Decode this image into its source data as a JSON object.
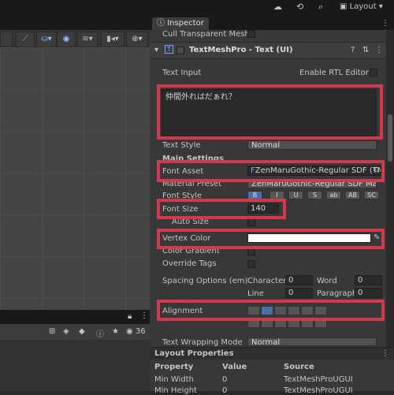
{
  "toolbar": {
    "cloud_icon": "cloud-icon",
    "history_icon": "history-icon",
    "search_icon": "search-icon",
    "layout_label": "Layout"
  },
  "scene": {
    "tools": [
      "▲▼",
      "◉",
      "≡",
      "▮▯",
      "⊕"
    ]
  },
  "bottom_panel": {
    "count_label": "36"
  },
  "inspector": {
    "tab_label": "Inspector",
    "cull_label": "Cull Transparent Mesh",
    "component_title": "TextMeshPro - Text (UI)",
    "text_input_label": "Text Input",
    "rtl_label": "Enable RTL Editor",
    "text_value": "仲間外れはだぁれ？",
    "text_style_label": "Text Style",
    "text_style_value": "Normal",
    "main_settings_label": "Main Settings",
    "font_asset_label": "Font Asset",
    "font_asset_value": "ZenMaruGothic-Regular SDF (TM",
    "material_preset_label": "Material Preset",
    "material_preset_value": "ZenMaruGothic-Regular SDF Material",
    "font_style_label": "Font Style",
    "font_style_buttons": [
      "B",
      "I",
      "U",
      "S",
      "ab",
      "AB",
      "SC"
    ],
    "font_size_label": "Font Size",
    "font_size_value": "140",
    "auto_size_label": "Auto Size",
    "vertex_color_label": "Vertex Color",
    "vertex_color_value": "#ffffff",
    "color_gradient_label": "Color Gradient",
    "override_tags_label": "Override Tags",
    "spacing_label": "Spacing Options (em)",
    "character_label": "Character",
    "character_value": "0",
    "word_label": "Word",
    "word_value": "0",
    "line_label": "Line",
    "line_value": "0",
    "paragraph_label": "Paragraph",
    "paragraph_value": "0",
    "alignment_label": "Alignment",
    "wrapping_label": "Text Wrapping Mode",
    "wrapping_value": "Normal"
  },
  "layout_properties": {
    "header": "Layout Properties",
    "col_property": "Property",
    "col_value": "Value",
    "col_source": "Source",
    "rows": [
      {
        "property": "Min Width",
        "value": "0",
        "source": "TextMeshProUGUI"
      },
      {
        "property": "Min Height",
        "value": "0",
        "source": "TextMeshProUGUI"
      }
    ]
  },
  "colors": {
    "highlight": "#d03a4c",
    "panel": "#383838",
    "accent": "#8ec2ff"
  }
}
